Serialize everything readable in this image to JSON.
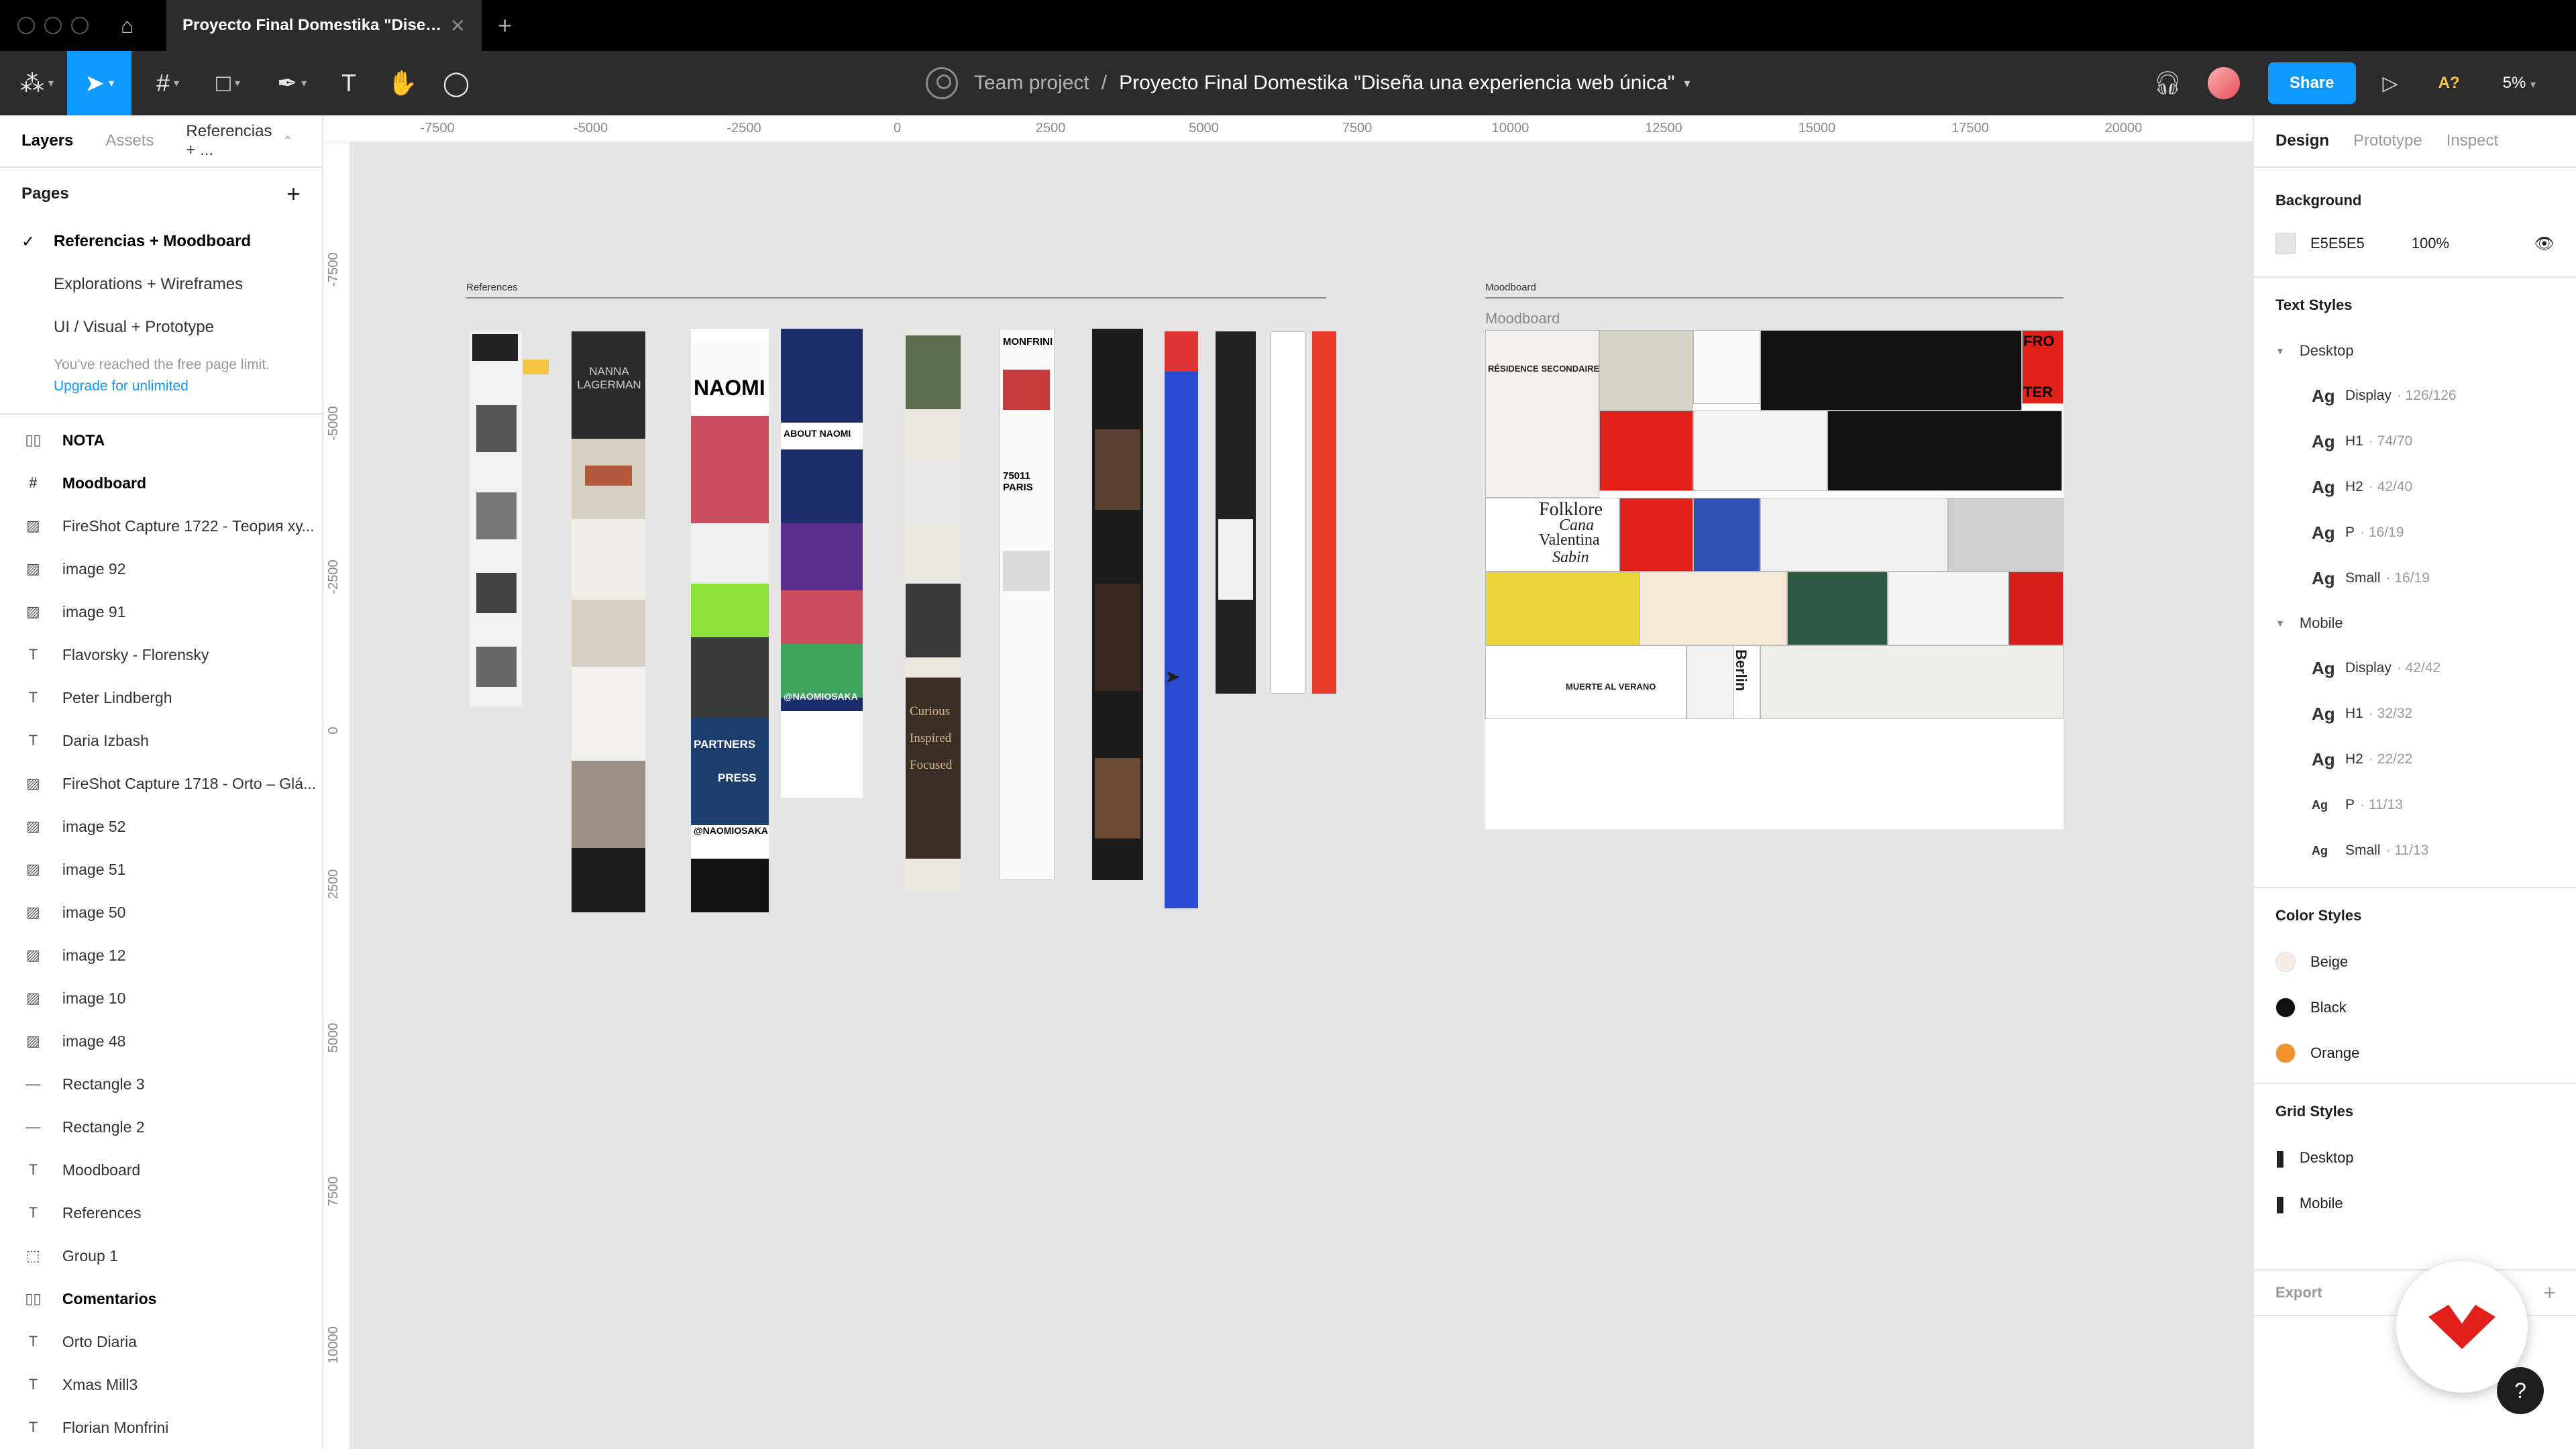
{
  "tab": {
    "title": "Proyecto Final Domestika \"Diseña u...",
    "close": "✕",
    "new_tab": "+"
  },
  "toolbar": {
    "breadcrumb_team": "Team project",
    "breadcrumb_sep": "/",
    "file_name": "Proyecto Final Domestika \"Diseña una experiencia web única\"",
    "share": "Share",
    "zoom": "5%",
    "avatar_hint": "A?"
  },
  "left_panel": {
    "tab_layers": "Layers",
    "tab_assets": "Assets",
    "page_selector": "Referencias + ...",
    "pages_title": "Pages",
    "pages": [
      {
        "label": "Referencias + Moodboard",
        "current": true
      },
      {
        "label": "Explorations + Wireframes",
        "current": false
      },
      {
        "label": "UI / Visual + Prototype",
        "current": false
      }
    ],
    "limit_text": "You've reached the free page limit.",
    "upgrade_link": "Upgrade for unlimited",
    "layers": [
      {
        "icon": "section-icon",
        "glyph": "▯▯",
        "label": "NOTA",
        "bold": true
      },
      {
        "icon": "frame-icon",
        "glyph": "#",
        "label": "Moodboard",
        "bold": true
      },
      {
        "icon": "image-icon",
        "glyph": "▨",
        "label": "FireShot Capture 1722 - Теория ху...",
        "bold": false
      },
      {
        "icon": "image-icon",
        "glyph": "▨",
        "label": "image 92",
        "bold": false
      },
      {
        "icon": "image-icon",
        "glyph": "▨",
        "label": "image 91",
        "bold": false
      },
      {
        "icon": "text-icon",
        "glyph": "T",
        "label": "Flavorsky - Florensky",
        "bold": false
      },
      {
        "icon": "text-icon",
        "glyph": "T",
        "label": "Peter Lindbergh",
        "bold": false
      },
      {
        "icon": "text-icon",
        "glyph": "T",
        "label": "Daria Izbash",
        "bold": false
      },
      {
        "icon": "image-icon",
        "glyph": "▨",
        "label": "FireShot Capture 1718 - Orto – Glá...",
        "bold": false
      },
      {
        "icon": "image-icon",
        "glyph": "▨",
        "label": "image 52",
        "bold": false
      },
      {
        "icon": "image-icon",
        "glyph": "▨",
        "label": "image 51",
        "bold": false
      },
      {
        "icon": "image-icon",
        "glyph": "▨",
        "label": "image 50",
        "bold": false
      },
      {
        "icon": "image-icon",
        "glyph": "▨",
        "label": "image 12",
        "bold": false
      },
      {
        "icon": "image-icon",
        "glyph": "▨",
        "label": "image 10",
        "bold": false
      },
      {
        "icon": "image-icon",
        "glyph": "▨",
        "label": "image 48",
        "bold": false
      },
      {
        "icon": "line-icon",
        "glyph": "—",
        "label": "Rectangle 3",
        "bold": false
      },
      {
        "icon": "line-icon",
        "glyph": "—",
        "label": "Rectangle 2",
        "bold": false
      },
      {
        "icon": "text-icon",
        "glyph": "T",
        "label": "Moodboard",
        "bold": false
      },
      {
        "icon": "text-icon",
        "glyph": "T",
        "label": "References",
        "bold": false
      },
      {
        "icon": "group-icon",
        "glyph": "⬚",
        "label": "Group 1",
        "bold": false
      },
      {
        "icon": "section-icon",
        "glyph": "▯▯",
        "label": "Comentarios",
        "bold": true
      },
      {
        "icon": "text-icon",
        "glyph": "T",
        "label": "Orto Diaria",
        "bold": false
      },
      {
        "icon": "text-icon",
        "glyph": "T",
        "label": "Xmas Mill3",
        "bold": false
      },
      {
        "icon": "text-icon",
        "glyph": "T",
        "label": "Florian Monfrini",
        "bold": false
      }
    ]
  },
  "right_panel": {
    "tab_design": "Design",
    "tab_prototype": "Prototype",
    "tab_inspect": "Inspect",
    "background_title": "Background",
    "background_hex": "E5E5E5",
    "background_opacity": "100%",
    "background_color": "#e5e5e5",
    "text_styles_title": "Text Styles",
    "groups": [
      {
        "name": "Desktop",
        "styles": [
          {
            "name": "Display",
            "meta": "· 126/126",
            "small": false
          },
          {
            "name": "H1",
            "meta": "· 74/70",
            "small": false
          },
          {
            "name": "H2",
            "meta": "· 42/40",
            "small": false
          },
          {
            "name": "P",
            "meta": "· 16/19",
            "small": false
          },
          {
            "name": "Small",
            "meta": "· 16/19",
            "small": false
          }
        ]
      },
      {
        "name": "Mobile",
        "styles": [
          {
            "name": "Display",
            "meta": "· 42/42",
            "small": false
          },
          {
            "name": "H1",
            "meta": "· 32/32",
            "small": false
          },
          {
            "name": "H2",
            "meta": "· 22/22",
            "small": false
          },
          {
            "name": "P",
            "meta": "· 11/13",
            "small": true
          },
          {
            "name": "Small",
            "meta": "· 11/13",
            "small": true
          }
        ]
      }
    ],
    "ag": "Ag",
    "color_styles_title": "Color Styles",
    "colors": [
      {
        "name": "Beige",
        "hex": "#f8ece6"
      },
      {
        "name": "Black",
        "hex": "#111111"
      },
      {
        "name": "Orange",
        "hex": "#f0922b"
      }
    ],
    "grid_styles_title": "Grid Styles",
    "grids": [
      "Desktop",
      "Mobile"
    ],
    "export_title": "Export",
    "help": "?"
  },
  "canvas": {
    "ruler_top": [
      "-7500",
      "-5000",
      "-2500",
      "0",
      "2500",
      "5000",
      "7500",
      "10000",
      "12500",
      "15000",
      "17500",
      "20000"
    ],
    "ruler_left": [
      "-7500",
      "-5000",
      "-2500",
      "0",
      "2500",
      "5000",
      "7500",
      "10000"
    ],
    "references_label": "References",
    "moodboard_label": "Moodboard",
    "moodboard_title": "Moodboard",
    "strip_texts": [
      "NANNA LAGERMAN",
      "NAOMI",
      "ABOUT NAOMI",
      "PARTNERS",
      "PRESS",
      "@NAOMIOSAKA",
      "MONFRINI",
      "75011 PARIS",
      "Curious",
      "Inspired",
      "Focused"
    ],
    "mood_texts": [
      "RÉSIDENCE SECONDAIRE",
      "Folklore",
      "Cana",
      "Valentina",
      "Sabin",
      "Berlin",
      "MUERTE AL VERANO",
      "FRO",
      "TER"
    ]
  }
}
